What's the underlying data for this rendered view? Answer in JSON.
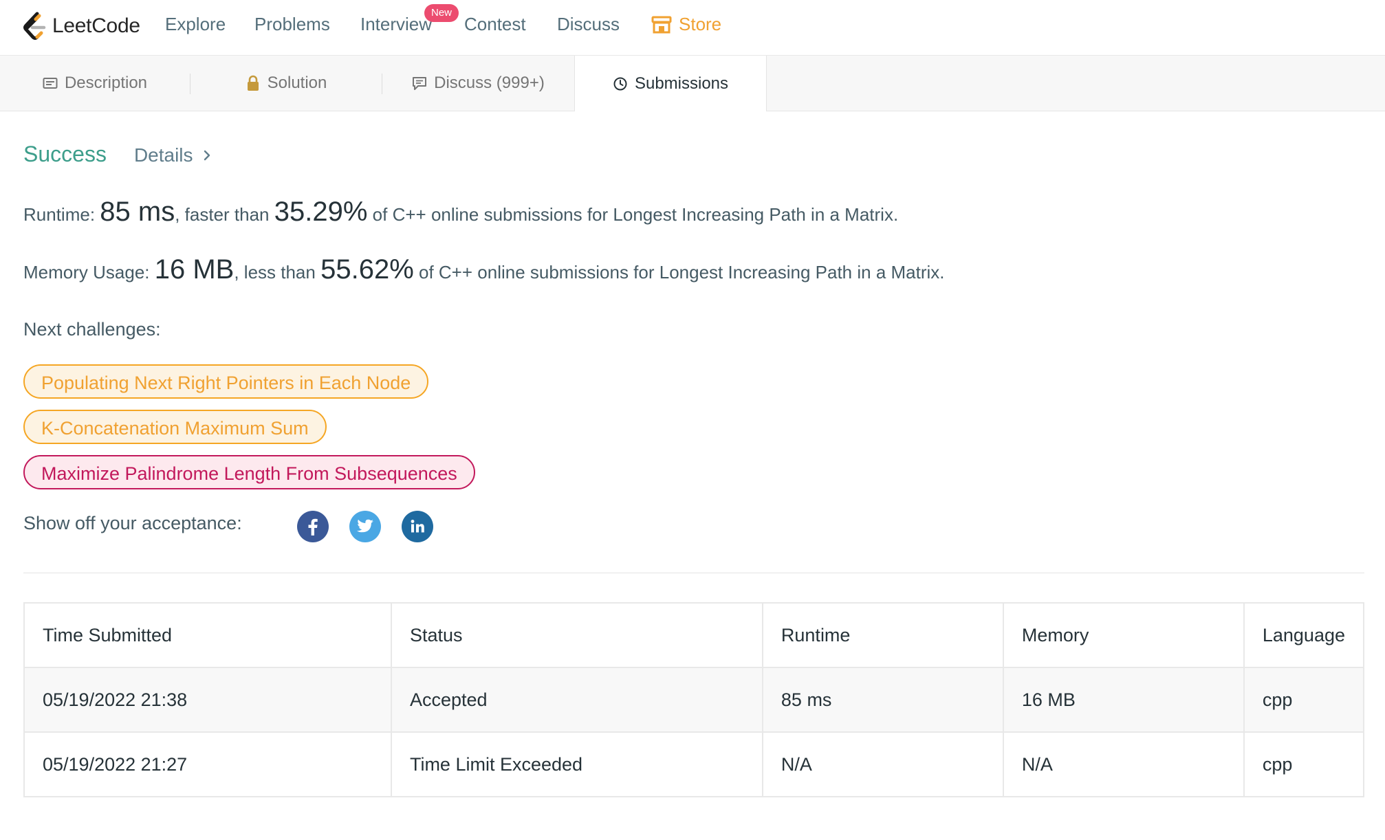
{
  "nav": {
    "brand": "LeetCode",
    "items": [
      "Explore",
      "Problems",
      "Interview",
      "Contest",
      "Discuss"
    ],
    "new_badge": "New",
    "store": "Store"
  },
  "tabs": {
    "description": "Description",
    "solution": "Solution",
    "discuss": "Discuss (999+)",
    "submissions": "Submissions"
  },
  "result": {
    "status": "Success",
    "details": "Details",
    "runtime": {
      "label": "Runtime:",
      "value": "85 ms",
      "mid": ", faster than",
      "percent": "35.29%",
      "suffix": "of C++ online submissions for Longest Increasing Path in a Matrix."
    },
    "memory": {
      "label": "Memory Usage:",
      "value": "16 MB",
      "mid": ", less than",
      "percent": "55.62%",
      "suffix": "of C++ online submissions for Longest Increasing Path in a Matrix."
    }
  },
  "next_challenges": {
    "label": "Next challenges:",
    "items": [
      {
        "title": "Populating Next Right Pointers in Each Node",
        "difficulty": "medium"
      },
      {
        "title": "K-Concatenation Maximum Sum",
        "difficulty": "medium"
      },
      {
        "title": "Maximize Palindrome Length From Subsequences",
        "difficulty": "hard"
      }
    ]
  },
  "share": {
    "label": "Show off your acceptance:",
    "icons": [
      "facebook-icon",
      "twitter-icon",
      "linkedin-icon"
    ]
  },
  "submissions": {
    "headers": [
      "Time Submitted",
      "Status",
      "Runtime",
      "Memory",
      "Language"
    ],
    "rows": [
      {
        "time": "05/19/2022 21:38",
        "status": "Accepted",
        "runtime": "85 ms",
        "memory": "16 MB",
        "language": "cpp"
      },
      {
        "time": "05/19/2022 21:27",
        "status": "Time Limit Exceeded",
        "runtime": "N/A",
        "memory": "N/A",
        "language": "cpp"
      }
    ]
  },
  "colors": {
    "accepted": "#3d9e8b",
    "error": "#d32f2f",
    "store": "#f0a131",
    "new_badge": "#ec4c6f"
  }
}
